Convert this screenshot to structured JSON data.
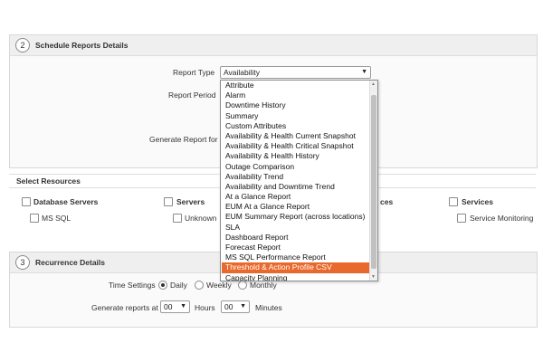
{
  "schedule": {
    "step": "2",
    "title": "Schedule Reports Details",
    "report_type_label": "Report Type",
    "report_type_value": "Availability",
    "report_period_label": "Report Period",
    "generate_for_label": "Generate Report for"
  },
  "resources": {
    "title": "Select Resources",
    "groups": [
      "Database Servers",
      "Servers",
      "ces",
      "Services"
    ],
    "items": [
      "MS SQL",
      "Unknown",
      "Service Monitoring"
    ]
  },
  "dropdown": {
    "options": [
      "Attribute",
      "Alarm",
      "Downtime History",
      "Summary",
      "Custom Attributes",
      "Availability & Health Current Snapshot",
      "Availability & Health Critical Snapshot",
      "Availability & Health History",
      "Outage Comparison",
      "Availability Trend",
      "Availability and Downtime Trend",
      "At a Glance Report",
      "EUM At a Glance Report",
      "EUM Summary Report (across locations)",
      "SLA",
      "Dashboard Report",
      "Forecast Report",
      "MS SQL Performance Report",
      "Threshold & Action Profile CSV",
      "Capacity Planning"
    ],
    "selected_index": 18
  },
  "recurrence": {
    "step": "3",
    "title": "Recurrence Details",
    "time_settings_label": "Time Settings",
    "daily_label": "Daily",
    "weekly_label": "Weekly",
    "monthly_label": "Monthly",
    "selected": "Daily",
    "generate_at_label": "Generate reports at",
    "hours_value": "00",
    "hours_label": "Hours",
    "minutes_value": "00",
    "minutes_label": "Minutes"
  },
  "colors": {
    "highlight": "#e8692b"
  }
}
